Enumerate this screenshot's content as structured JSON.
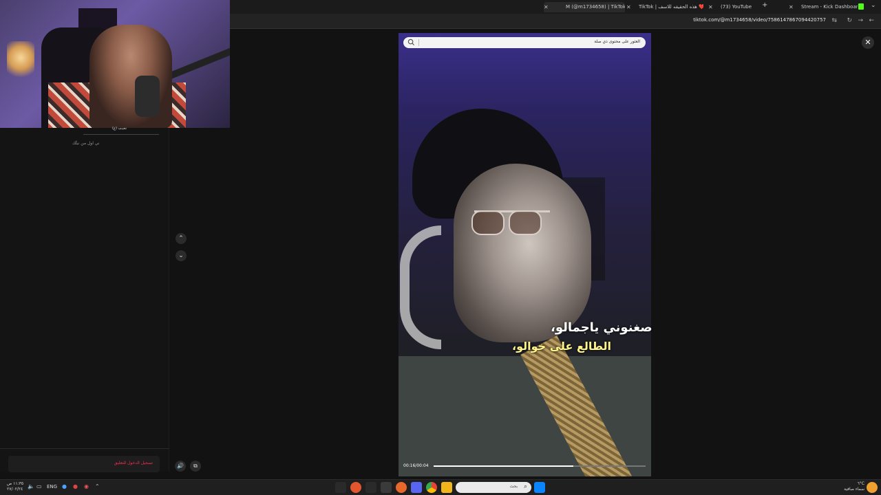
{
  "browser": {
    "tabs": [
      {
        "title": "M (@m1734658) | TikTok",
        "active": true
      },
      {
        "title": "TikTok | هذه الحقيقه للاسف ❤️"
      },
      {
        "title": "(73) YouTube"
      },
      {
        "title": "Stream - Kick Dashboard"
      }
    ],
    "url": "tiktok.com/@m1734658/video/7586147867094420757"
  },
  "stream_panel": {
    "name_label": "(ع) نحيـب",
    "note": "ني اول من نبتَّك"
  },
  "search": {
    "placeholder": "العثور على محتوى ذي صلة"
  },
  "video": {
    "caption_line1": "صغنوني ياجمالو،",
    "caption_line2": "الطالع على خوالو،",
    "timecode": "00:16/00:04",
    "progress_fraction": 0.66
  },
  "login_prompt": "تسجيل الدخول للتعليق",
  "taskbar": {
    "lang": "ENG",
    "search_placeholder": "بحث",
    "clock_time": "١١:٣٥ ص",
    "clock_date": "٢٧/٠٢/٢٤",
    "weather_temp": "٦°C",
    "weather_desc": "سماء صافية"
  },
  "colors": {
    "tiktok_red": "#fe2c55",
    "kick_green": "#53fc18",
    "caption_yellow": "#fff68a"
  }
}
